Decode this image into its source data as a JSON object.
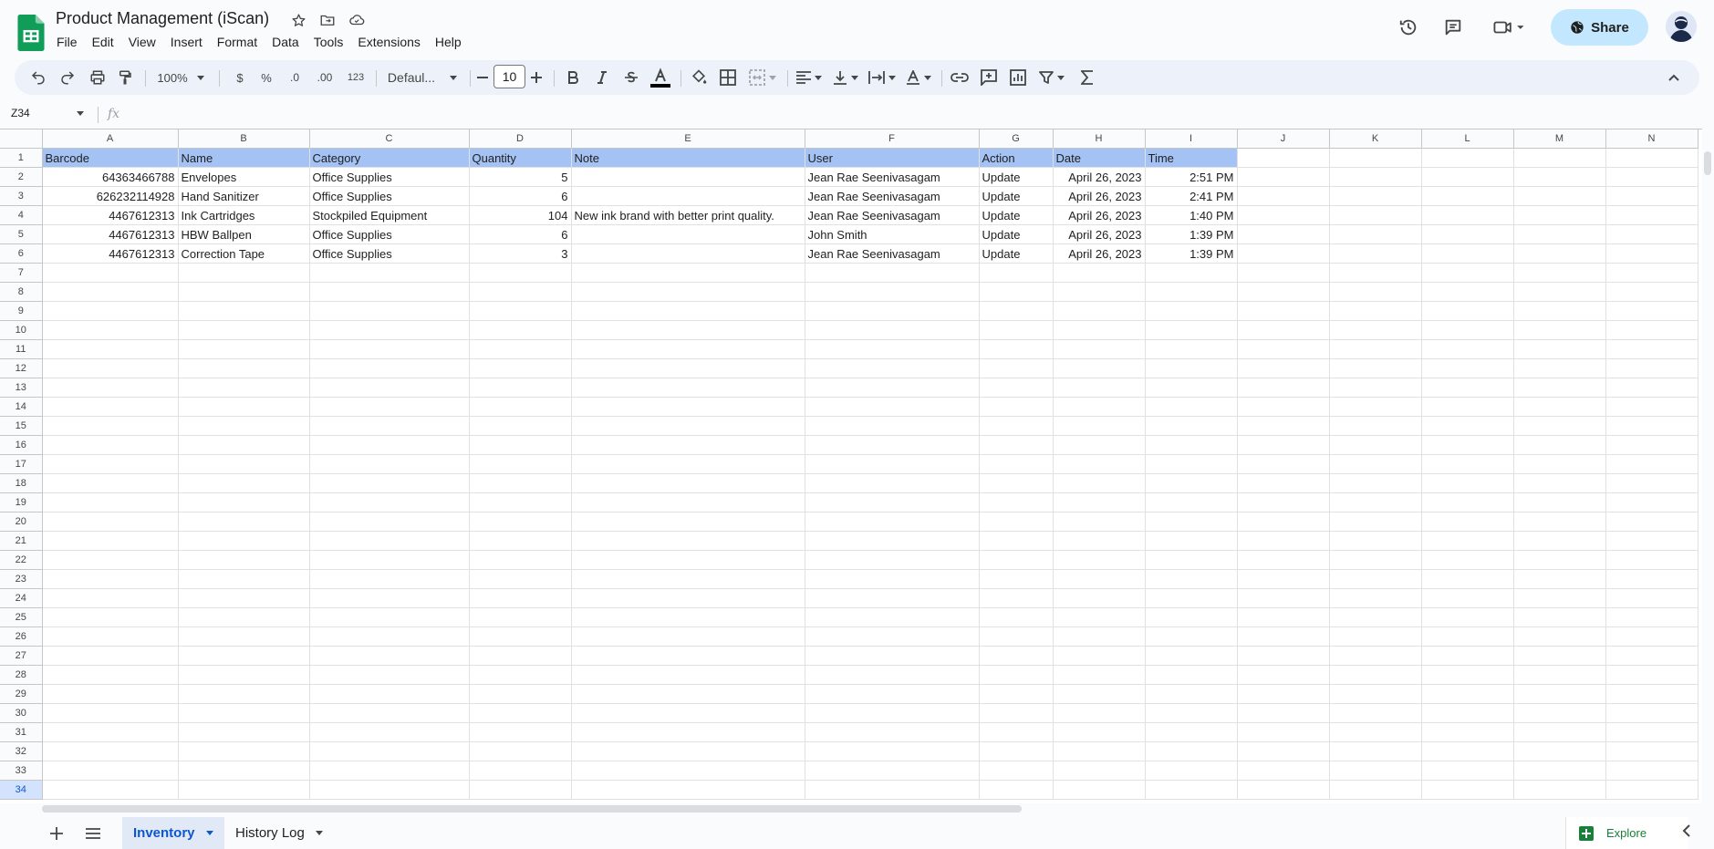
{
  "doc": {
    "title": "Product Management (iScan)"
  },
  "menu": [
    "File",
    "Edit",
    "View",
    "Insert",
    "Format",
    "Data",
    "Tools",
    "Extensions",
    "Help"
  ],
  "share_label": "Share",
  "toolbar": {
    "zoom": "100%",
    "currency": "$",
    "percent": "%",
    "dec_decrease": ".0",
    "dec_increase": ".00",
    "number_format": "123",
    "font": "Defaul...",
    "font_size": "10"
  },
  "formula_bar": {
    "cell_ref": "Z34",
    "fx": "fx",
    "value": ""
  },
  "columns": [
    "A",
    "B",
    "C",
    "D",
    "E",
    "F",
    "G",
    "H",
    "I",
    "J",
    "K",
    "L",
    "M",
    "N"
  ],
  "row_numbers": [
    "1",
    "2",
    "3",
    "4",
    "5",
    "6",
    "7",
    "8",
    "9",
    "10",
    "11",
    "12",
    "13",
    "14",
    "15",
    "16",
    "17",
    "18",
    "19",
    "20",
    "21",
    "22",
    "23",
    "24",
    "25",
    "26",
    "27",
    "28",
    "29",
    "30",
    "31",
    "32",
    "33",
    "34"
  ],
  "table": {
    "headers": [
      "Barcode",
      "Name",
      "Category",
      "Quantity",
      "Note",
      "User",
      "Action",
      "Date",
      "Time"
    ],
    "rows": [
      [
        "64363466788",
        "Envelopes",
        "Office Supplies",
        "5",
        "",
        "Jean Rae Seenivasagam",
        "Update",
        "April 26, 2023",
        "2:51 PM"
      ],
      [
        "626232114928",
        "Hand Sanitizer",
        "Office Supplies",
        "6",
        "",
        "Jean Rae Seenivasagam",
        "Update",
        "April 26, 2023",
        "2:41 PM"
      ],
      [
        "4467612313",
        "Ink Cartridges",
        "Stockpiled Equipment",
        "104",
        "New ink brand with better print quality.",
        "Jean Rae Seenivasagam",
        "Update",
        "April 26, 2023",
        "1:40 PM"
      ],
      [
        "4467612313",
        "HBW Ballpen",
        "Office Supplies",
        "6",
        "",
        "John Smith",
        "Update",
        "April 26, 2023",
        "1:39 PM"
      ],
      [
        "4467612313",
        "Correction Tape",
        "Office Supplies",
        "3",
        "",
        "Jean Rae Seenivasagam",
        "Update",
        "April 26, 2023",
        "1:39 PM"
      ]
    ]
  },
  "sheets": [
    {
      "name": "Inventory",
      "active": true
    },
    {
      "name": "History Log",
      "active": false
    }
  ],
  "explore_label": "Explore",
  "colors": {
    "accent": "#0b57d0",
    "header_fill": "#a4c2f4",
    "share_bg": "#c2e7ff",
    "sheets_green": "#188038"
  }
}
